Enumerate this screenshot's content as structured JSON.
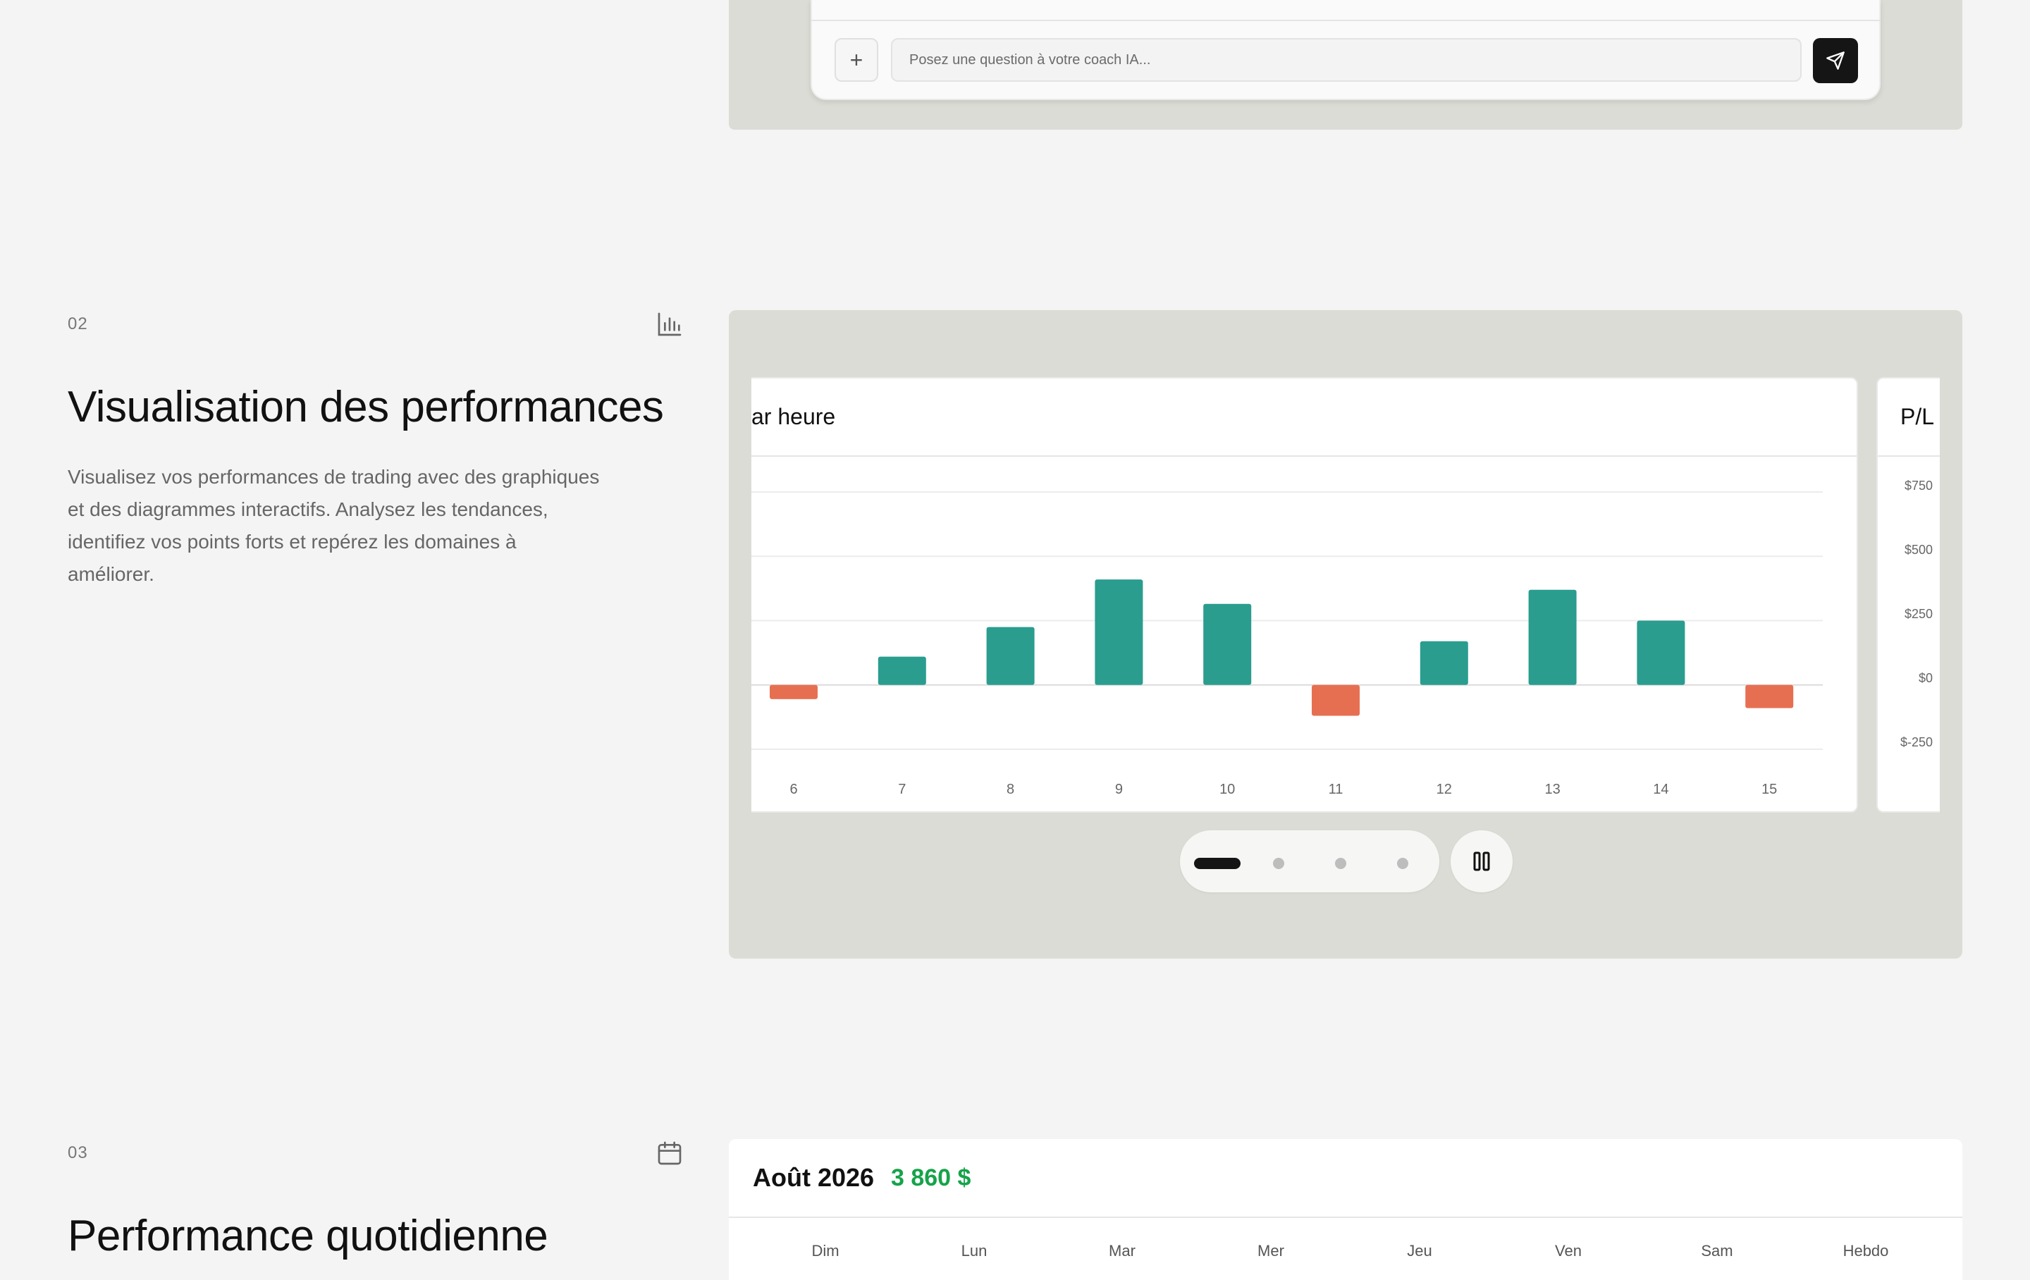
{
  "chat": {
    "placeholder": "Posez une question à votre coach IA...",
    "attach_icon": "plus-icon",
    "send_icon": "send-icon"
  },
  "section2": {
    "number": "02",
    "title": "Visualisation des performances",
    "description": "Visualisez vos performances de trading avec des graphiques et des diagrammes interactifs. Analysez les tendances, identifiez vos points forts et repérez les domaines à améliorer.",
    "icon": "bar-chart-icon",
    "next_card_title": "P/L",
    "next_card_ticks": [
      "$750",
      "$500",
      "$250",
      "$0",
      "$-250"
    ]
  },
  "chart_data": {
    "type": "bar",
    "title": "ar heure",
    "categories": [
      "6",
      "7",
      "8",
      "9",
      "10",
      "11",
      "12",
      "13",
      "14",
      "15"
    ],
    "values": [
      -55,
      110,
      225,
      410,
      315,
      -120,
      170,
      370,
      250,
      -90
    ],
    "ylim": [
      -250,
      750
    ],
    "colors": {
      "positive": "#2a9d8f",
      "negative": "#e76f51"
    },
    "grid": true
  },
  "carousel": {
    "slides": 4,
    "active_index": 0,
    "pause_icon": "pause-icon"
  },
  "section3": {
    "number": "03",
    "title": "Performance quotidienne",
    "icon": "calendar-icon",
    "month": "Août 2026",
    "total": "3 860 $",
    "weekdays": [
      "Dim",
      "Lun",
      "Mar",
      "Mer",
      "Jeu",
      "Ven",
      "Sam",
      "Hebdo"
    ]
  },
  "colors": {
    "accent_green": "#16a34a",
    "panel_bg": "#dcdcd6",
    "page_bg": "#f4f4f4"
  }
}
